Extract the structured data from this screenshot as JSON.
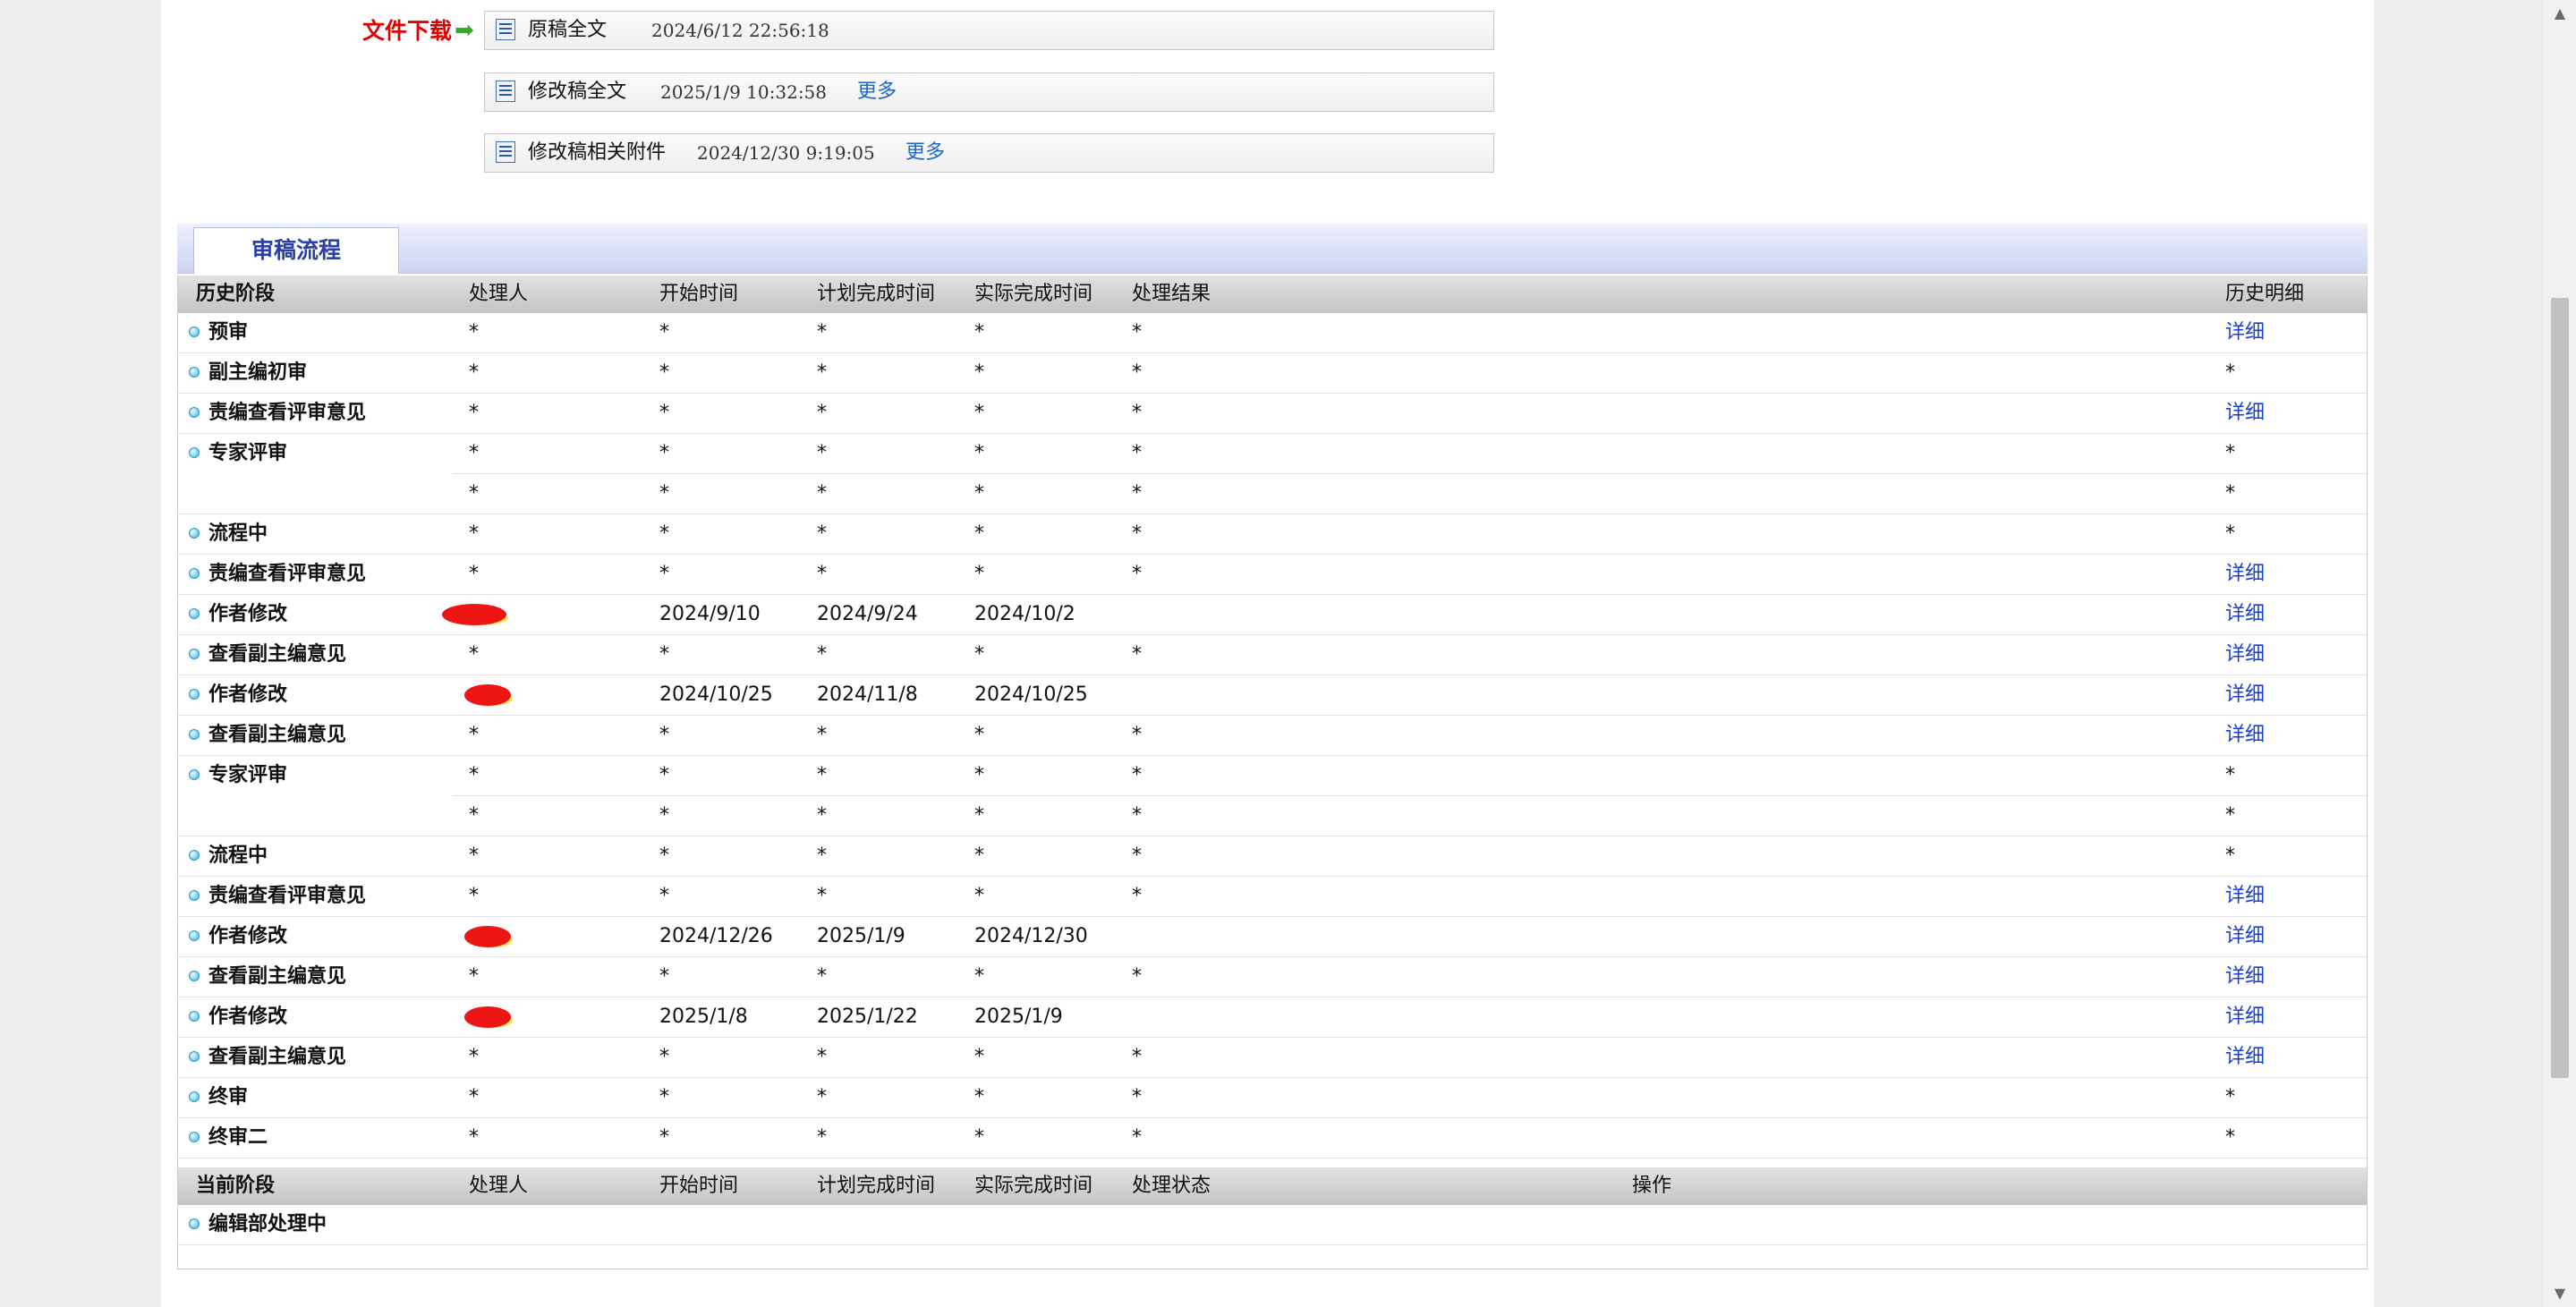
{
  "files": {
    "label": "文件下载",
    "items": [
      {
        "name": "原稿全文",
        "time": "2024/6/12 22:56:18",
        "more": ""
      },
      {
        "name": "修改稿全文",
        "time": "2025/1/9 10:32:58",
        "more": "更多"
      },
      {
        "name": "修改稿相关附件",
        "time": "2024/12/30 9:19:05",
        "more": "更多"
      }
    ]
  },
  "process": {
    "tab_label": "审稿流程",
    "history_headers": [
      "历史阶段",
      "处理人",
      "开始时间",
      "计划完成时间",
      "实际完成时间",
      "处理结果",
      "历史明细"
    ],
    "history_rows": [
      {
        "stage": "预审",
        "handler": "*",
        "start": "*",
        "plan": "*",
        "actual": "*",
        "result": "*",
        "detail": "详细"
      },
      {
        "stage": "副主编初审",
        "handler": "*",
        "start": "*",
        "plan": "*",
        "actual": "*",
        "result": "*",
        "detail": "*"
      },
      {
        "stage": "责编查看评审意见",
        "handler": "*",
        "start": "*",
        "plan": "*",
        "actual": "*",
        "result": "*",
        "detail": "详细"
      },
      {
        "stage": "专家评审",
        "handler": "*",
        "start": "*",
        "plan": "*",
        "actual": "*",
        "result": "*",
        "detail": "*"
      },
      {
        "stage": "",
        "handler": "*",
        "start": "*",
        "plan": "*",
        "actual": "*",
        "result": "*",
        "detail": "*"
      },
      {
        "stage": "流程中",
        "handler": "*",
        "start": "*",
        "plan": "*",
        "actual": "*",
        "result": "*",
        "detail": "*"
      },
      {
        "stage": "责编查看评审意见",
        "handler": "*",
        "start": "*",
        "plan": "*",
        "actual": "*",
        "result": "*",
        "detail": "详细"
      },
      {
        "stage": "作者修改",
        "handler": "",
        "start": "2024/9/10",
        "plan": "2024/9/24",
        "actual": "2024/10/2",
        "result": "",
        "detail": "详细"
      },
      {
        "stage": "查看副主编意见",
        "handler": "*",
        "start": "*",
        "plan": "*",
        "actual": "*",
        "result": "*",
        "detail": "详细"
      },
      {
        "stage": "作者修改",
        "handler": "",
        "start": "2024/10/25",
        "plan": "2024/11/8",
        "actual": "2024/10/25",
        "result": "",
        "detail": "详细"
      },
      {
        "stage": "查看副主编意见",
        "handler": "*",
        "start": "*",
        "plan": "*",
        "actual": "*",
        "result": "*",
        "detail": "详细"
      },
      {
        "stage": "专家评审",
        "handler": "*",
        "start": "*",
        "plan": "*",
        "actual": "*",
        "result": "*",
        "detail": "*"
      },
      {
        "stage": "",
        "handler": "*",
        "start": "*",
        "plan": "*",
        "actual": "*",
        "result": "*",
        "detail": "*"
      },
      {
        "stage": "流程中",
        "handler": "*",
        "start": "*",
        "plan": "*",
        "actual": "*",
        "result": "*",
        "detail": "*"
      },
      {
        "stage": "责编查看评审意见",
        "handler": "*",
        "start": "*",
        "plan": "*",
        "actual": "*",
        "result": "*",
        "detail": "详细"
      },
      {
        "stage": "作者修改",
        "handler": "",
        "start": "2024/12/26",
        "plan": "2025/1/9",
        "actual": "2024/12/30",
        "result": "",
        "detail": "详细"
      },
      {
        "stage": "查看副主编意见",
        "handler": "*",
        "start": "*",
        "plan": "*",
        "actual": "*",
        "result": "*",
        "detail": "详细"
      },
      {
        "stage": "作者修改",
        "handler": "",
        "start": "2025/1/8",
        "plan": "2025/1/22",
        "actual": "2025/1/9",
        "result": "",
        "detail": "详细"
      },
      {
        "stage": "查看副主编意见",
        "handler": "*",
        "start": "*",
        "plan": "*",
        "actual": "*",
        "result": "*",
        "detail": "详细"
      },
      {
        "stage": "终审",
        "handler": "*",
        "start": "*",
        "plan": "*",
        "actual": "*",
        "result": "*",
        "detail": "*"
      },
      {
        "stage": "终审二",
        "handler": "*",
        "start": "*",
        "plan": "*",
        "actual": "*",
        "result": "*",
        "detail": "*"
      }
    ],
    "current_headers": [
      "当前阶段",
      "处理人",
      "开始时间",
      "计划完成时间",
      "实际完成时间",
      "处理状态",
      "操作"
    ],
    "current_rows": [
      {
        "stage": "编辑部处理中"
      }
    ]
  },
  "colors": {
    "download_label": "#e10000",
    "link": "#1a3fd1",
    "tab_text": "#2b3fa6",
    "redaction": "#ee1515"
  }
}
